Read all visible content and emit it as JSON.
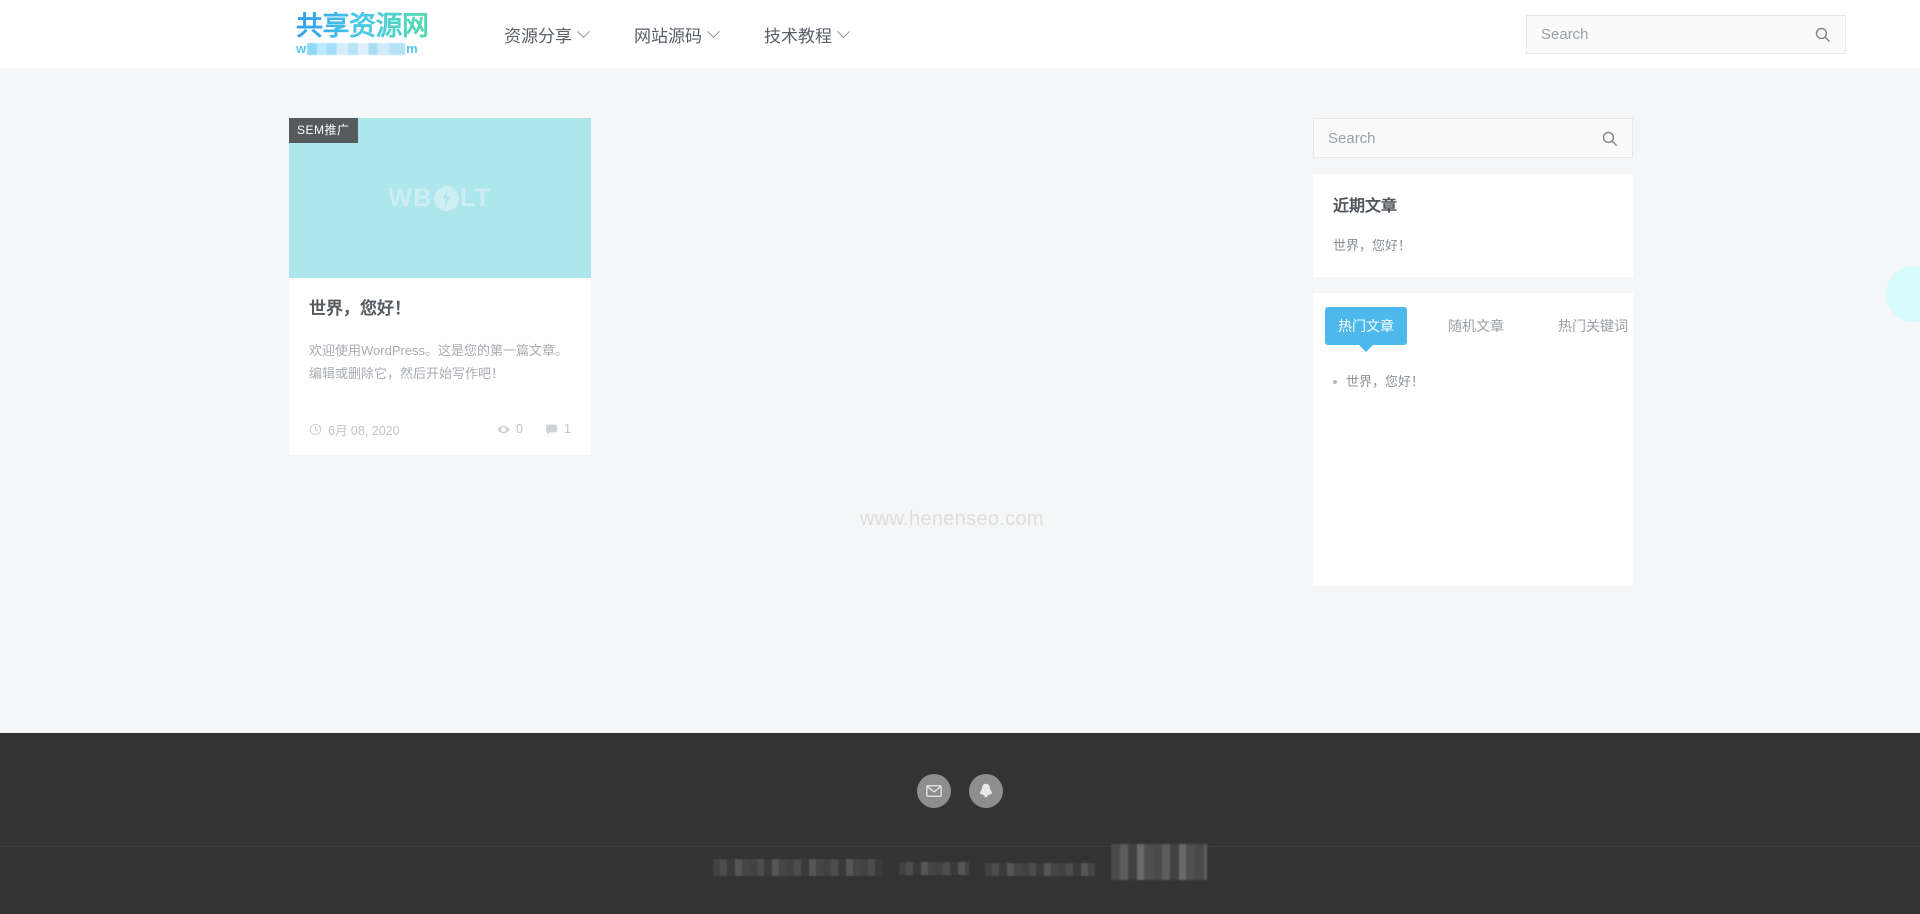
{
  "header": {
    "brand": {
      "title": "共享资源网",
      "sub_prefix": "w",
      "sub_suffix": "m",
      "redacted": true
    },
    "nav": [
      {
        "label": "资源分享",
        "icon": "chevron-down-icon"
      },
      {
        "label": "网站源码",
        "icon": "chevron-down-icon"
      },
      {
        "label": "技术教程",
        "icon": "chevron-down-icon"
      }
    ],
    "search": {
      "placeholder": "Search",
      "value": "",
      "icon": "search-icon"
    }
  },
  "main": {
    "watermark": "www.henenseo.com",
    "post": {
      "badge": "SEM推广",
      "thumbnail_watermark": "WBOLT",
      "thumbnail_color": "#aee6ed",
      "title": "世界，您好！",
      "excerpt": "欢迎使用WordPress。这是您的第一篇文章。编辑或删除它，然后开始写作吧！",
      "date": "6月 08, 2020",
      "date_icon": "clock-icon",
      "views": "0",
      "views_icon": "eye-icon",
      "comments": "1",
      "comments_icon": "comment-icon"
    }
  },
  "sidebar": {
    "search": {
      "placeholder": "Search",
      "value": "",
      "icon": "search-icon"
    },
    "recent": {
      "title": "近期文章",
      "items": [
        "世界，您好！"
      ]
    },
    "tabs": {
      "items": [
        {
          "label": "热门文章",
          "active": true
        },
        {
          "label": "随机文章",
          "active": false
        },
        {
          "label": "热门关键词",
          "active": false
        }
      ],
      "active_color": "#4cb8ec",
      "panel_items": [
        "世界，您好！"
      ]
    }
  },
  "footer": {
    "social": [
      {
        "name": "email-icon",
        "glyph": "envelope"
      },
      {
        "name": "qq-icon",
        "glyph": "penguin"
      }
    ],
    "background": "#333333",
    "bottom_redacted": true
  },
  "floating": {
    "bubble_color": "#d6fbfb"
  }
}
